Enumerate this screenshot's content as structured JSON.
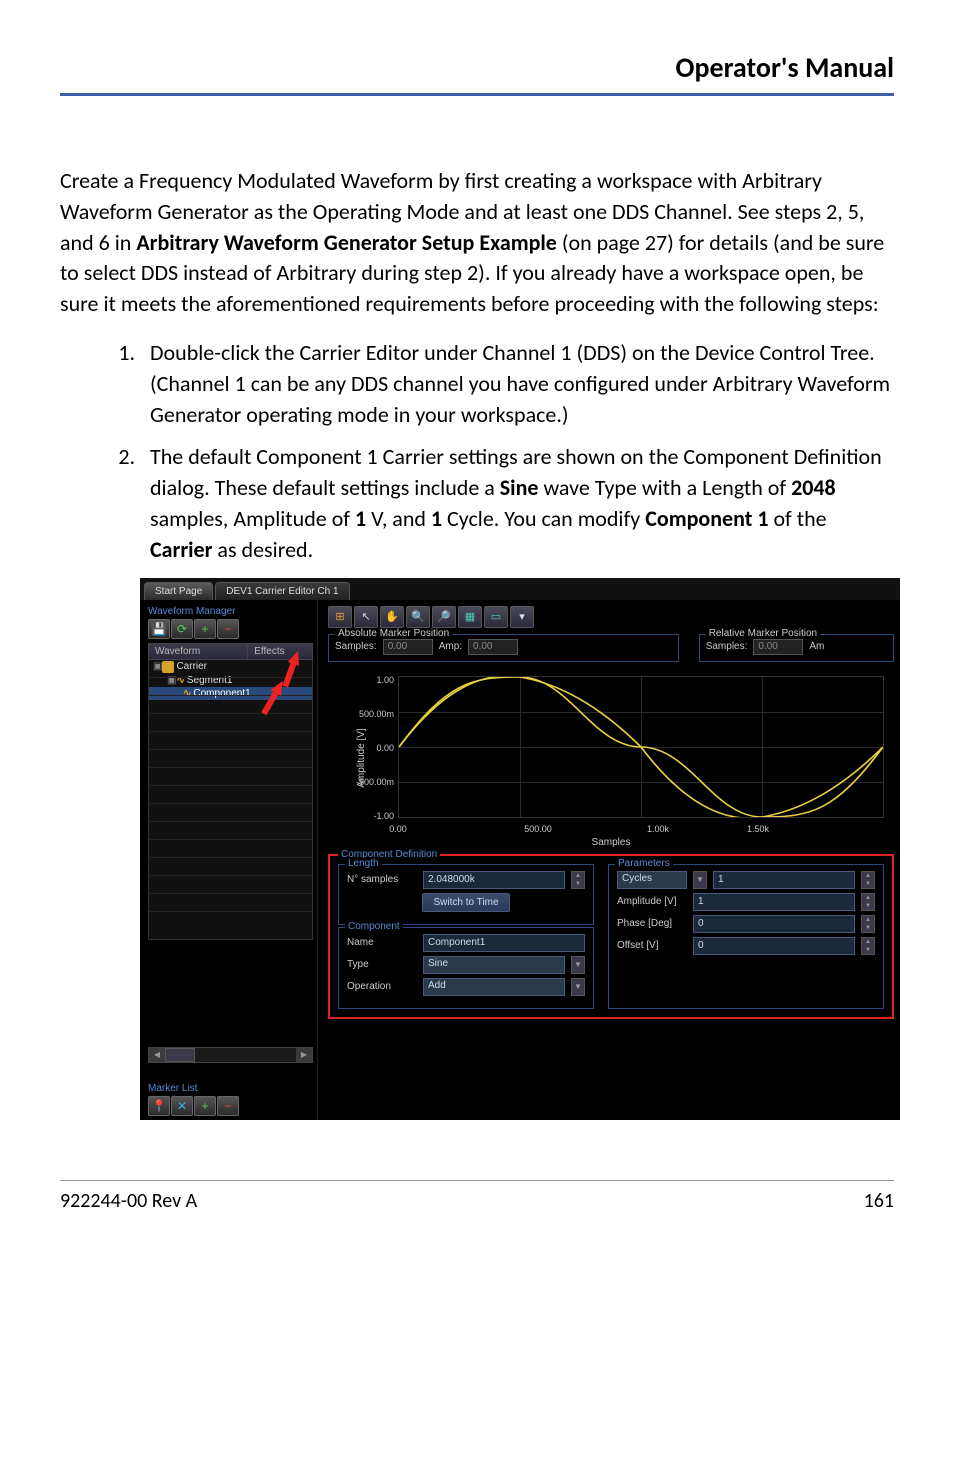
{
  "header": {
    "title": "Operator's Manual"
  },
  "intro": {
    "p1a": "Create a Frequency Modulated Waveform by first creating a workspace with Arbitrary Waveform Generator as the Operating Mode and at least one DDS Channel. See steps 2, 5, and 6 in ",
    "p1b": "Arbitrary Waveform Generator Setup Example",
    "p1c": " (on page 27) for details (and be sure to select DDS instead of Arbitrary during step 2). If you already have a workspace open, be sure it meets the aforementioned requirements before proceeding with the following steps:"
  },
  "steps": {
    "s1": "Double-click the Carrier Editor under Channel 1 (DDS) on the Device Control Tree. (Channel 1 can be any DDS channel you have configured under Arbitrary Waveform Generator operating mode in your workspace.)",
    "s2a": "The default Component 1 Carrier settings are shown on the Component Definition dialog. These default settings include a ",
    "s2b": "Sine",
    "s2c": " wave Type with a Length of ",
    "s2d": "2048",
    "s2e": " samples, Amplitude of ",
    "s2f": "1",
    "s2g": " V, and ",
    "s2h": "1",
    "s2i": " Cycle. You can modify ",
    "s2j": "Component 1",
    "s2k": " of the ",
    "s2l": "Carrier",
    "s2m": " as desired."
  },
  "ui": {
    "tabs": {
      "start": "Start Page",
      "editor": "DEV1 Carrier Editor Ch 1"
    },
    "waveform_manager": {
      "title": "Waveform Manager",
      "col_waveform": "Waveform",
      "col_effects": "Effects",
      "carrier": "Carrier",
      "segment": "Segment1",
      "component": "Component1"
    },
    "marker_list": {
      "title": "Marker List"
    },
    "abs_marker": {
      "title": "Absolute Marker Position",
      "samples_lbl": "Samples:",
      "samples_val": "0.00",
      "amp_lbl": "Amp:",
      "amp_val": "0.00"
    },
    "rel_marker": {
      "title": "Relative Marker Position",
      "samples_lbl": "Samples:",
      "samples_val": "0.00",
      "amp_lbl": "Am"
    },
    "chart": {
      "ylabel": "Amplitude [V]",
      "xlabel": "Samples",
      "yticks": [
        "1.00",
        "500.00m",
        "0.00",
        "-500.00m",
        "-1.00"
      ],
      "xticks": [
        "0.00",
        "500.00",
        "1.00k",
        "1.50k"
      ]
    },
    "comp_def": {
      "title": "Component Definition",
      "length": {
        "title": "Length",
        "n_samples_lbl": "N° samples",
        "n_samples_val": "2.048000k",
        "switch_btn": "Switch to Time"
      },
      "component": {
        "title": "Component",
        "name_lbl": "Name",
        "name_val": "Component1",
        "type_lbl": "Type",
        "type_val": "Sine",
        "op_lbl": "Operation",
        "op_val": "Add"
      },
      "parameters": {
        "title": "Parameters",
        "cycles_lbl": "Cycles",
        "cycles_val": "1",
        "amp_lbl": "Amplitude [V]",
        "amp_val": "1",
        "phase_lbl": "Phase [Deg]",
        "phase_val": "0",
        "offset_lbl": "Offset [V]",
        "offset_val": "0"
      }
    }
  },
  "chart_data": {
    "type": "line",
    "title": "",
    "xlabel": "Samples",
    "ylabel": "Amplitude [V]",
    "xlim": [
      0,
      2048
    ],
    "ylim": [
      -1.0,
      1.0
    ],
    "xticks": [
      0,
      500,
      1000,
      1500
    ],
    "yticks": [
      -1.0,
      -0.5,
      0.0,
      0.5,
      1.0
    ],
    "series": [
      {
        "name": "Component1",
        "function": "sine",
        "cycles": 1,
        "amplitude": 1.0,
        "phase_deg": 0,
        "offset": 0,
        "samples": 2048
      }
    ]
  },
  "footer": {
    "left": "922244-00 Rev A",
    "right": "161"
  }
}
